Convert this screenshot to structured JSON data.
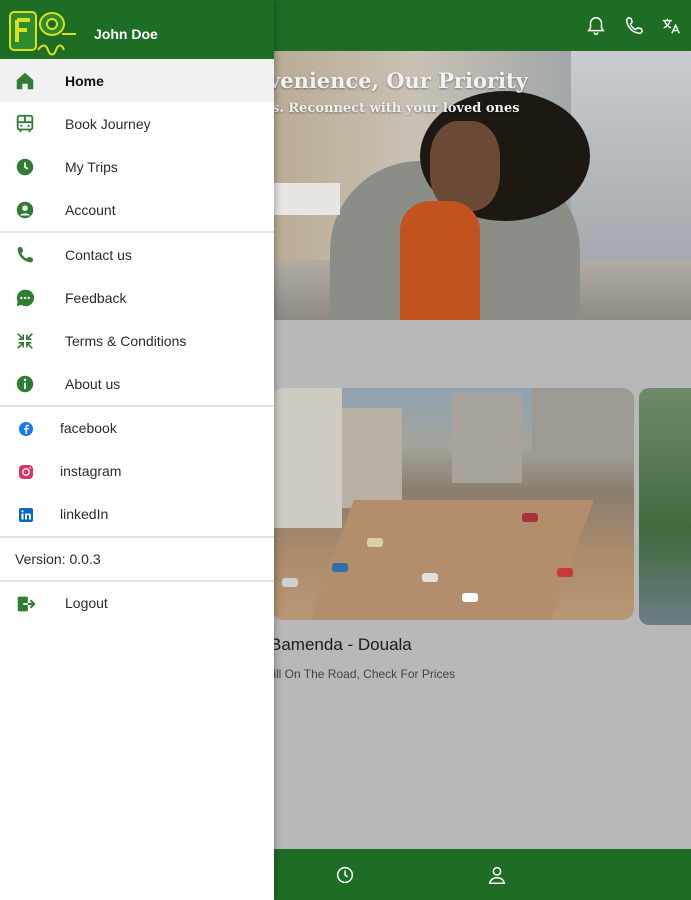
{
  "drawer": {
    "user_name": "John Doe",
    "logo_icon": "gotraveler-logo",
    "primary_items": [
      {
        "label": "Home",
        "icon": "home-icon",
        "active": true
      },
      {
        "label": "Book Journey",
        "icon": "bus-icon"
      },
      {
        "label": "My Trips",
        "icon": "clock-icon"
      },
      {
        "label": "Account",
        "icon": "account-icon"
      }
    ],
    "secondary_items": [
      {
        "label": "Contact us",
        "icon": "phone-icon"
      },
      {
        "label": "Feedback",
        "icon": "chat-icon"
      },
      {
        "label": "Terms & Conditions",
        "icon": "compress-icon"
      },
      {
        "label": "About us",
        "icon": "info-icon"
      }
    ],
    "social_items": [
      {
        "label": "facebook",
        "icon": "facebook-icon"
      },
      {
        "label": "instagram",
        "icon": "instagram-icon"
      },
      {
        "label": "linkedIn",
        "icon": "linkedin-icon"
      }
    ],
    "version": "Version: 0.0.3",
    "logout_label": "Logout"
  },
  "background": {
    "hero_title": "venience, Our Priority",
    "hero_subtitle": "s. Reconnect with your loved ones",
    "route_title": "Bamenda - Douala",
    "route_subtitle": "till On The Road, Check For Prices",
    "appbar_icons": [
      "bell-icon",
      "phone-icon",
      "translate-icon"
    ],
    "bottom_nav_icons": [
      "history-icon",
      "profile-icon"
    ]
  },
  "colors": {
    "brand_green": "#1e6d24",
    "icon_green": "#2f7d32"
  }
}
